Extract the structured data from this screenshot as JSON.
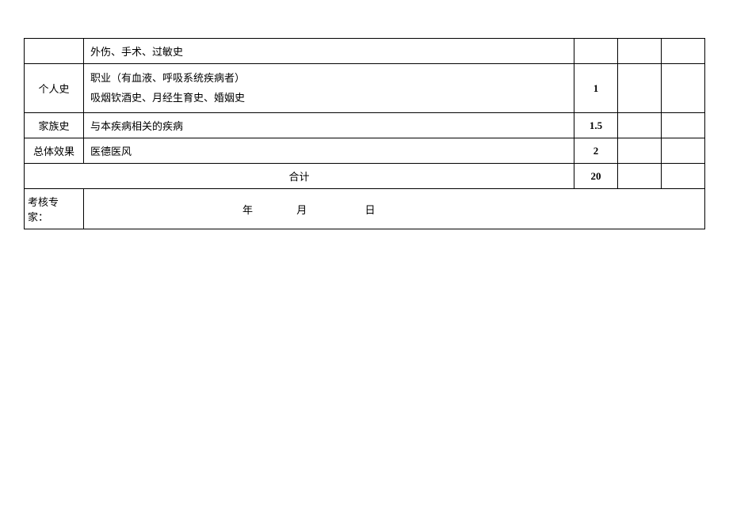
{
  "rows": {
    "trauma": {
      "content": "外伤、手术、过敏史"
    },
    "personal": {
      "category": "个人史",
      "content_line1": "职业（有血液、呼吸系统疾病者）",
      "content_line2": "吸烟钦酒史、月经生育史、婚姻史",
      "score": "1"
    },
    "family": {
      "category": "家族史",
      "content": "与本疾病相关的疾病",
      "score": "1.5"
    },
    "overall": {
      "category": "总体效果",
      "content": "医德医风",
      "score": "2"
    },
    "total": {
      "label": "合计",
      "score": "20"
    }
  },
  "footer": {
    "examiner_label": "考核专家：",
    "year_label": "年",
    "month_label": "月",
    "day_label": "日"
  }
}
